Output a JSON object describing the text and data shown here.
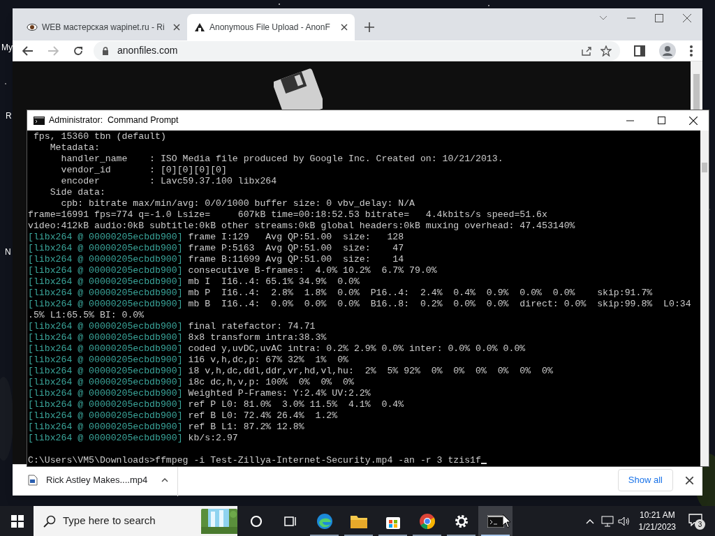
{
  "desktop": {
    "icon_labels": [
      "My",
      "R",
      "N"
    ]
  },
  "browser": {
    "tabs": [
      {
        "title": "WEB мастерская wapinet.ru - Ri",
        "selected": false
      },
      {
        "title": "Anonymous File Upload - AnonF",
        "selected": true
      }
    ],
    "address": "anonfiles.com",
    "download": {
      "file": "Rick Astley Makes....mp4",
      "show_all": "Show all"
    }
  },
  "console": {
    "title": "Administrator:  Command Prompt",
    "lines": [
      {
        "text": " fps, 15360 tbn (default)"
      },
      {
        "text": "    Metadata:"
      },
      {
        "text": "      handler_name    : ISO Media file produced by Google Inc. Created on: 10/21/2013."
      },
      {
        "text": "      vendor_id       : [0][0][0][0]"
      },
      {
        "text": "      encoder         : Lavc59.37.100 libx264"
      },
      {
        "text": "    Side data:"
      },
      {
        "text": "      cpb: bitrate max/min/avg: 0/0/1000 buffer size: 0 vbv_delay: N/A"
      },
      {
        "text": "frame=16991 fps=774 q=-1.0 Lsize=     607kB time=00:18:52.53 bitrate=   4.4kbits/s speed=51.6x"
      },
      {
        "text": "video:412kB audio:0kB subtitle:0kB other streams:0kB global headers:0kB muxing overhead: 47.453140%"
      },
      {
        "prefix": "[libx264 @ 00000205ecbdb900]",
        "text": " frame I:129   Avg QP:51.00  size:   128"
      },
      {
        "prefix": "[libx264 @ 00000205ecbdb900]",
        "text": " frame P:5163  Avg QP:51.00  size:    47"
      },
      {
        "prefix": "[libx264 @ 00000205ecbdb900]",
        "text": " frame B:11699 Avg QP:51.00  size:    14"
      },
      {
        "prefix": "[libx264 @ 00000205ecbdb900]",
        "text": " consecutive B-frames:  4.0% 10.2%  6.7% 79.0%"
      },
      {
        "prefix": "[libx264 @ 00000205ecbdb900]",
        "text": " mb I  I16..4: 65.1% 34.9%  0.0%"
      },
      {
        "prefix": "[libx264 @ 00000205ecbdb900]",
        "text": " mb P  I16..4:  2.8%  1.8%  0.0%  P16..4:  2.4%  0.4%  0.9%  0.0%  0.0%    skip:91.7%"
      },
      {
        "prefix": "[libx264 @ 00000205ecbdb900]",
        "text": " mb B  I16..4:  0.0%  0.0%  0.0%  B16..8:  0.2%  0.0%  0.0%  direct: 0.0%  skip:99.8%  L0:34"
      },
      {
        "text": ".5% L1:65.5% BI: 0.0%"
      },
      {
        "prefix": "[libx264 @ 00000205ecbdb900]",
        "text": " final ratefactor: 74.71"
      },
      {
        "prefix": "[libx264 @ 00000205ecbdb900]",
        "text": " 8x8 transform intra:38.3%"
      },
      {
        "prefix": "[libx264 @ 00000205ecbdb900]",
        "text": " coded y,uvDC,uvAC intra: 0.2% 2.9% 0.0% inter: 0.0% 0.0% 0.0%"
      },
      {
        "prefix": "[libx264 @ 00000205ecbdb900]",
        "text": " i16 v,h,dc,p: 67% 32%  1%  0%"
      },
      {
        "prefix": "[libx264 @ 00000205ecbdb900]",
        "text": " i8 v,h,dc,ddl,ddr,vr,hd,vl,hu:  2%  5% 92%  0%  0%  0%  0%  0%  0%"
      },
      {
        "prefix": "[libx264 @ 00000205ecbdb900]",
        "text": " i8c dc,h,v,p: 100%  0%  0%  0%"
      },
      {
        "prefix": "[libx264 @ 00000205ecbdb900]",
        "text": " Weighted P-Frames: Y:2.4% UV:2.2%"
      },
      {
        "prefix": "[libx264 @ 00000205ecbdb900]",
        "text": " ref P L0: 81.0%  3.0% 11.5%  4.1%  0.4%"
      },
      {
        "prefix": "[libx264 @ 00000205ecbdb900]",
        "text": " ref B L0: 72.4% 26.4%  1.2%"
      },
      {
        "prefix": "[libx264 @ 00000205ecbdb900]",
        "text": " ref B L1: 87.2% 12.8%"
      },
      {
        "prefix": "[libx264 @ 00000205ecbdb900]",
        "text": " kb/s:2.97"
      }
    ],
    "prompt": "C:\\Users\\VM5\\Downloads>ffmpeg -i Test-Zillya-Internet-Security.mp4 -an -r 3 tzis1f"
  },
  "taskbar": {
    "search_placeholder": "Type here to search",
    "apps": [
      {
        "kind": "cortana",
        "selected": false
      },
      {
        "kind": "taskview",
        "selected": false
      },
      {
        "kind": "edge",
        "selected": false
      },
      {
        "kind": "folder",
        "selected": false
      },
      {
        "kind": "store",
        "selected": false
      },
      {
        "kind": "chrome",
        "selected": false
      },
      {
        "kind": "settings",
        "selected": false
      },
      {
        "kind": "cmd",
        "selected": true
      }
    ],
    "time": "10:21 AM",
    "date": "1/21/2023",
    "notification_count": "3"
  }
}
